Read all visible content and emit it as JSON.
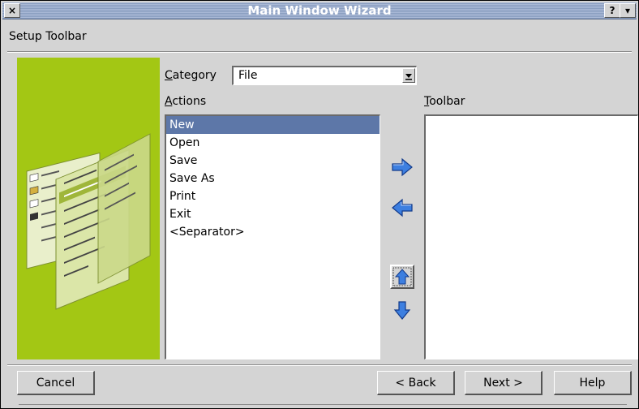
{
  "window": {
    "title": "Main Window Wizard",
    "close_label": "×",
    "help_label": "?",
    "menu_label": "▾"
  },
  "page": {
    "title": "Setup Toolbar"
  },
  "category": {
    "label_u": "C",
    "label_rest": "ategory",
    "value": "File"
  },
  "actions": {
    "label_u": "A",
    "label_rest": "ctions",
    "items": [
      "New",
      "Open",
      "Save",
      "Save As",
      "Print",
      "Exit",
      "<Separator>"
    ],
    "selected_index": 0
  },
  "toolbar": {
    "label_u": "T",
    "label_rest": "oolbar",
    "items": []
  },
  "buttons": {
    "cancel": "Cancel",
    "back": "< Back",
    "next": "Next >",
    "help": "Help"
  },
  "colors": {
    "accent": "#5d77a8",
    "image_bg": "#a3c714",
    "arrow_blue": "#3d7fe0"
  },
  "icons": {
    "add": "arrow-right-icon",
    "remove": "arrow-left-icon",
    "up": "arrow-up-icon",
    "down": "arrow-down-icon"
  }
}
